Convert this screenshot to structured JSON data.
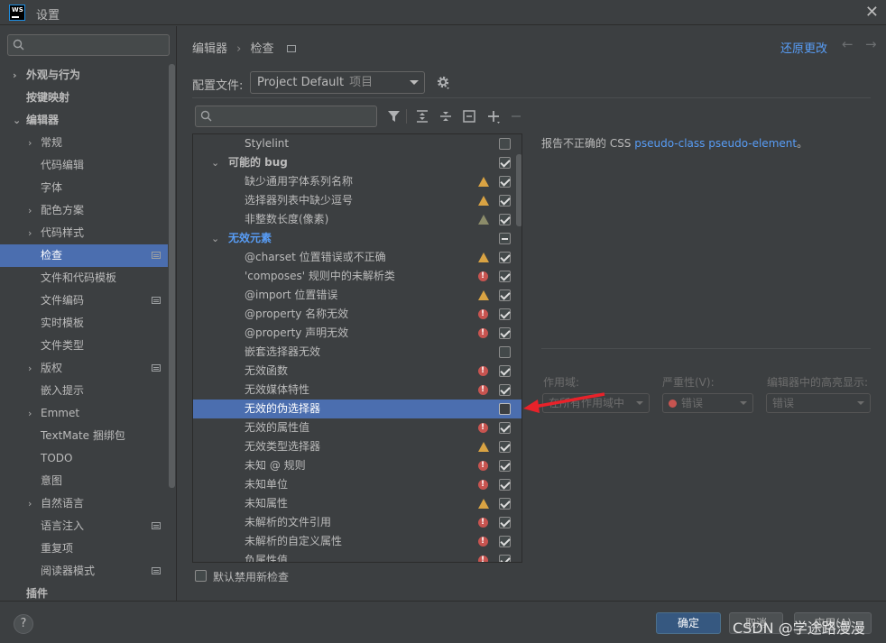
{
  "window": {
    "title": "设置",
    "logo_text": "WS"
  },
  "sidebar": {
    "search_placeholder": "",
    "items": [
      {
        "label": "外观与行为",
        "chevron": "›",
        "level": 0,
        "bold": true
      },
      {
        "label": "按键映射",
        "chevron": "",
        "level": 0,
        "bold": true
      },
      {
        "label": "编辑器",
        "chevron": "⌄",
        "level": 0,
        "bold": true
      },
      {
        "label": "常规",
        "chevron": "›",
        "level": 1
      },
      {
        "label": "代码编辑",
        "chevron": "",
        "level": 1
      },
      {
        "label": "字体",
        "chevron": "",
        "level": 1
      },
      {
        "label": "配色方案",
        "chevron": "›",
        "level": 1
      },
      {
        "label": "代码样式",
        "chevron": "›",
        "level": 1
      },
      {
        "label": "检查",
        "chevron": "",
        "level": 1,
        "selected": true,
        "proj": true
      },
      {
        "label": "文件和代码模板",
        "chevron": "",
        "level": 1
      },
      {
        "label": "文件编码",
        "chevron": "",
        "level": 1,
        "proj": true
      },
      {
        "label": "实时模板",
        "chevron": "",
        "level": 1
      },
      {
        "label": "文件类型",
        "chevron": "",
        "level": 1
      },
      {
        "label": "版权",
        "chevron": "›",
        "level": 1,
        "proj": true
      },
      {
        "label": "嵌入提示",
        "chevron": "",
        "level": 1
      },
      {
        "label": "Emmet",
        "chevron": "›",
        "level": 1
      },
      {
        "label": "TextMate 捆绑包",
        "chevron": "",
        "level": 1
      },
      {
        "label": "TODO",
        "chevron": "",
        "level": 1
      },
      {
        "label": "意图",
        "chevron": "",
        "level": 1
      },
      {
        "label": "自然语言",
        "chevron": "›",
        "level": 1
      },
      {
        "label": "语言注入",
        "chevron": "",
        "level": 1,
        "proj": true
      },
      {
        "label": "重复项",
        "chevron": "",
        "level": 1
      },
      {
        "label": "阅读器模式",
        "chevron": "",
        "level": 1,
        "proj": true
      },
      {
        "label": "插件",
        "chevron": "",
        "level": 0,
        "bold": true
      }
    ]
  },
  "header": {
    "breadcrumb": [
      "编辑器",
      "检查"
    ],
    "breadcrumb_sep": "›",
    "revert_label": "还原更改",
    "back_arrow": "←",
    "forward_arrow": "→"
  },
  "profile": {
    "label": "配置文件:",
    "value": "Project Default",
    "sub": "项目"
  },
  "inspections": {
    "filter_placeholder": "",
    "rows": [
      {
        "label": "Stylelint",
        "type": "item",
        "severity": "",
        "check": "empty"
      },
      {
        "label": "可能的 bug",
        "type": "group",
        "severity": "",
        "check": "checked"
      },
      {
        "label": "缺少通用字体系列名称",
        "type": "item",
        "severity": "warn",
        "check": "checked"
      },
      {
        "label": "选择器列表中缺少逗号",
        "type": "item",
        "severity": "warn",
        "check": "checked"
      },
      {
        "label": "非整数长度(像素)",
        "type": "item",
        "severity": "weak",
        "check": "checked"
      },
      {
        "label": "无效元素",
        "type": "group-blue",
        "severity": "",
        "check": "mixed"
      },
      {
        "label": "@charset 位置错误或不正确",
        "type": "item",
        "severity": "warn",
        "check": "checked"
      },
      {
        "label": "'composes' 规则中的未解析类",
        "type": "item",
        "severity": "err",
        "check": "checked"
      },
      {
        "label": "@import 位置错误",
        "type": "item",
        "severity": "warn",
        "check": "checked"
      },
      {
        "label": "@property 名称无效",
        "type": "item",
        "severity": "err",
        "check": "checked"
      },
      {
        "label": "@property 声明无效",
        "type": "item",
        "severity": "err",
        "check": "checked"
      },
      {
        "label": "嵌套选择器无效",
        "type": "item",
        "severity": "",
        "check": "empty"
      },
      {
        "label": "无效函数",
        "type": "item",
        "severity": "err",
        "check": "checked"
      },
      {
        "label": "无效媒体特性",
        "type": "item",
        "severity": "err",
        "check": "checked"
      },
      {
        "label": "无效的伪选择器",
        "type": "item",
        "severity": "",
        "check": "sel-empty",
        "selected": true
      },
      {
        "label": "无效的属性值",
        "type": "item",
        "severity": "err",
        "check": "checked"
      },
      {
        "label": "无效类型选择器",
        "type": "item",
        "severity": "warn",
        "check": "checked"
      },
      {
        "label": "未知 @ 规则",
        "type": "item",
        "severity": "err",
        "check": "checked"
      },
      {
        "label": "未知单位",
        "type": "item",
        "severity": "err",
        "check": "checked"
      },
      {
        "label": "未知属性",
        "type": "item",
        "severity": "warn",
        "check": "checked"
      },
      {
        "label": "未解析的文件引用",
        "type": "item",
        "severity": "err",
        "check": "checked"
      },
      {
        "label": "未解析的自定义属性",
        "type": "item",
        "severity": "err",
        "check": "checked"
      },
      {
        "label": "负属性值",
        "type": "item",
        "severity": "err",
        "check": "checked"
      }
    ]
  },
  "description": {
    "prefix": "报告不正确的 CSS ",
    "link": "pseudo-class pseudo-element",
    "suffix": "。"
  },
  "options": {
    "scope_label": "作用域:",
    "scope_value": "在所有作用域中",
    "severity_label": "严重性(V):",
    "severity_value": "错误",
    "highlight_label": "编辑器中的高亮显示:",
    "highlight_value": "错误"
  },
  "footer": {
    "default_disable_label": "默认禁用新检查",
    "help": "?",
    "ok": "确定",
    "cancel": "取消",
    "apply": "应用(A)",
    "watermark": "CSDN @学途路漫漫"
  },
  "colors": {
    "accent": "#4b6eaf",
    "link": "#589df6",
    "error": "#c75450",
    "warning": "#d9a343",
    "arrow": "#e8222a"
  }
}
